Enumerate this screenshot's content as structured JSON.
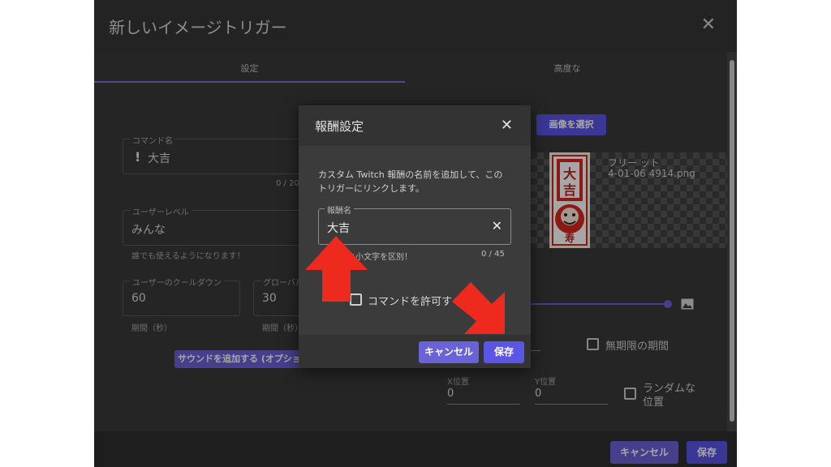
{
  "dialog": {
    "title": "新しいイメージトリガー",
    "close_icon": "✕",
    "tabs": [
      {
        "label": "設定",
        "active": true
      },
      {
        "label": "高度な",
        "active": false
      }
    ],
    "command_name": {
      "label": "コマンド名",
      "value": "大吉",
      "counter": "0 / 20"
    },
    "user_level": {
      "label": "ユーザーレベル",
      "value": "みんな",
      "hint": "誰でも使えるようになります！"
    },
    "user_cooldown": {
      "label": "ユーザーのクールダウン",
      "value": "60",
      "unit": "期間（秒）"
    },
    "global_cooldown": {
      "label": "グローバル",
      "value": "30",
      "unit": "期間（秒）"
    },
    "add_sound_button": "サウンドを追加する (オプショ",
    "select_image_button": "画像を選択",
    "image_filename_line1": "フリー    ット",
    "image_filename_line2": "4-01-06   4914.png",
    "unlimited_period_label": "無期限の期間",
    "x_position": {
      "label": "X位置",
      "value": "0"
    },
    "y_position": {
      "label": "Y位置",
      "value": "0"
    },
    "random_position_label_1": "ランダムな",
    "random_position_label_2": "位置",
    "footer_cancel": "キャンセル",
    "footer_save": "保存"
  },
  "reward_modal": {
    "title": "報酬設定",
    "close_icon": "✕",
    "description_line1": "カスタム Twitch 報酬の名前を追加して、この",
    "description_line2": "トリガーにリンクします。",
    "reward_name": {
      "label": "報酬名",
      "value": "大吉",
      "hint": "と小文字を区別！",
      "counter": "0 / 45"
    },
    "allow_command_label": "コマンドを許可す",
    "cancel_button": "キャンセル",
    "save_button": "保存"
  },
  "colors": {
    "accent": "#5a55e6",
    "button_purple": "#6a62d8",
    "arrow_red": "#ee2a1e"
  }
}
